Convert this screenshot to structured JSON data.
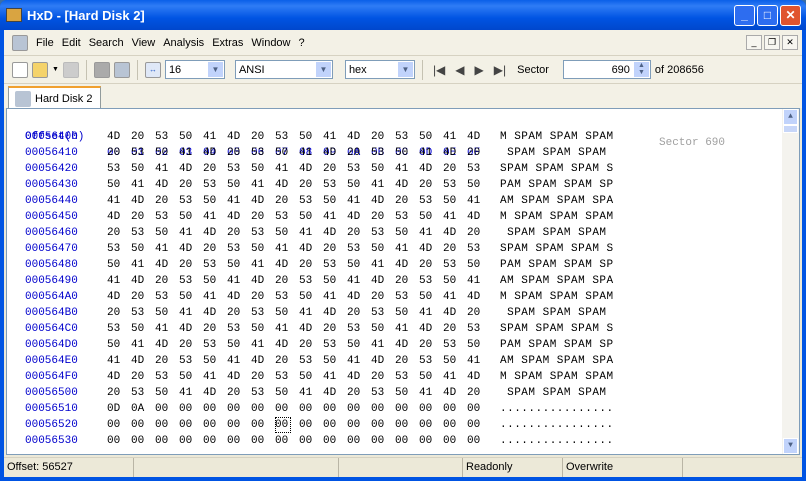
{
  "window": {
    "title": "HxD - [Hard Disk 2]",
    "app_icon_text": "HxD"
  },
  "menu": [
    "File",
    "Edit",
    "Search",
    "View",
    "Analysis",
    "Extras",
    "Window",
    "?"
  ],
  "toolbar": {
    "bytes_per_row": "16",
    "charset": "ANSI",
    "offset_base": "hex",
    "sector_label": "Sector",
    "sector_value": "690",
    "sector_total": "of 208656"
  },
  "tab": {
    "label": "Hard Disk 2"
  },
  "editor": {
    "header_offset": "Offset(h)",
    "header_cols": [
      "00",
      "01",
      "02",
      "03",
      "04",
      "05",
      "06",
      "07",
      "08",
      "09",
      "0A",
      "0B",
      "0C",
      "0D",
      "0E",
      "0F"
    ],
    "sector_annotation": "Sector 690",
    "rows": [
      {
        "offset": "00056400",
        "hex": [
          "4D",
          "20",
          "53",
          "50",
          "41",
          "4D",
          "20",
          "53",
          "50",
          "41",
          "4D",
          "20",
          "53",
          "50",
          "41",
          "4D"
        ],
        "text": "M SPAM SPAM SPAM"
      },
      {
        "offset": "00056410",
        "hex": [
          "20",
          "53",
          "50",
          "41",
          "4D",
          "20",
          "53",
          "50",
          "41",
          "4D",
          "20",
          "53",
          "50",
          "41",
          "4D",
          "20"
        ],
        "text": " SPAM SPAM SPAM "
      },
      {
        "offset": "00056420",
        "hex": [
          "53",
          "50",
          "41",
          "4D",
          "20",
          "53",
          "50",
          "41",
          "4D",
          "20",
          "53",
          "50",
          "41",
          "4D",
          "20",
          "53"
        ],
        "text": "SPAM SPAM SPAM S"
      },
      {
        "offset": "00056430",
        "hex": [
          "50",
          "41",
          "4D",
          "20",
          "53",
          "50",
          "41",
          "4D",
          "20",
          "53",
          "50",
          "41",
          "4D",
          "20",
          "53",
          "50"
        ],
        "text": "PAM SPAM SPAM SP"
      },
      {
        "offset": "00056440",
        "hex": [
          "41",
          "4D",
          "20",
          "53",
          "50",
          "41",
          "4D",
          "20",
          "53",
          "50",
          "41",
          "4D",
          "20",
          "53",
          "50",
          "41"
        ],
        "text": "AM SPAM SPAM SPA"
      },
      {
        "offset": "00056450",
        "hex": [
          "4D",
          "20",
          "53",
          "50",
          "41",
          "4D",
          "20",
          "53",
          "50",
          "41",
          "4D",
          "20",
          "53",
          "50",
          "41",
          "4D"
        ],
        "text": "M SPAM SPAM SPAM"
      },
      {
        "offset": "00056460",
        "hex": [
          "20",
          "53",
          "50",
          "41",
          "4D",
          "20",
          "53",
          "50",
          "41",
          "4D",
          "20",
          "53",
          "50",
          "41",
          "4D",
          "20"
        ],
        "text": " SPAM SPAM SPAM "
      },
      {
        "offset": "00056470",
        "hex": [
          "53",
          "50",
          "41",
          "4D",
          "20",
          "53",
          "50",
          "41",
          "4D",
          "20",
          "53",
          "50",
          "41",
          "4D",
          "20",
          "53"
        ],
        "text": "SPAM SPAM SPAM S"
      },
      {
        "offset": "00056480",
        "hex": [
          "50",
          "41",
          "4D",
          "20",
          "53",
          "50",
          "41",
          "4D",
          "20",
          "53",
          "50",
          "41",
          "4D",
          "20",
          "53",
          "50"
        ],
        "text": "PAM SPAM SPAM SP"
      },
      {
        "offset": "00056490",
        "hex": [
          "41",
          "4D",
          "20",
          "53",
          "50",
          "41",
          "4D",
          "20",
          "53",
          "50",
          "41",
          "4D",
          "20",
          "53",
          "50",
          "41"
        ],
        "text": "AM SPAM SPAM SPA"
      },
      {
        "offset": "000564A0",
        "hex": [
          "4D",
          "20",
          "53",
          "50",
          "41",
          "4D",
          "20",
          "53",
          "50",
          "41",
          "4D",
          "20",
          "53",
          "50",
          "41",
          "4D"
        ],
        "text": "M SPAM SPAM SPAM"
      },
      {
        "offset": "000564B0",
        "hex": [
          "20",
          "53",
          "50",
          "41",
          "4D",
          "20",
          "53",
          "50",
          "41",
          "4D",
          "20",
          "53",
          "50",
          "41",
          "4D",
          "20"
        ],
        "text": " SPAM SPAM SPAM "
      },
      {
        "offset": "000564C0",
        "hex": [
          "53",
          "50",
          "41",
          "4D",
          "20",
          "53",
          "50",
          "41",
          "4D",
          "20",
          "53",
          "50",
          "41",
          "4D",
          "20",
          "53"
        ],
        "text": "SPAM SPAM SPAM S"
      },
      {
        "offset": "000564D0",
        "hex": [
          "50",
          "41",
          "4D",
          "20",
          "53",
          "50",
          "41",
          "4D",
          "20",
          "53",
          "50",
          "41",
          "4D",
          "20",
          "53",
          "50"
        ],
        "text": "PAM SPAM SPAM SP"
      },
      {
        "offset": "000564E0",
        "hex": [
          "41",
          "4D",
          "20",
          "53",
          "50",
          "41",
          "4D",
          "20",
          "53",
          "50",
          "41",
          "4D",
          "20",
          "53",
          "50",
          "41"
        ],
        "text": "AM SPAM SPAM SPA"
      },
      {
        "offset": "000564F0",
        "hex": [
          "4D",
          "20",
          "53",
          "50",
          "41",
          "4D",
          "20",
          "53",
          "50",
          "41",
          "4D",
          "20",
          "53",
          "50",
          "41",
          "4D"
        ],
        "text": "M SPAM SPAM SPAM"
      },
      {
        "offset": "00056500",
        "hex": [
          "20",
          "53",
          "50",
          "41",
          "4D",
          "20",
          "53",
          "50",
          "41",
          "4D",
          "20",
          "53",
          "50",
          "41",
          "4D",
          "20"
        ],
        "text": " SPAM SPAM SPAM "
      },
      {
        "offset": "00056510",
        "hex": [
          "0D",
          "0A",
          "00",
          "00",
          "00",
          "00",
          "00",
          "00",
          "00",
          "00",
          "00",
          "00",
          "00",
          "00",
          "00",
          "00"
        ],
        "text": "................"
      },
      {
        "offset": "00056520",
        "hex": [
          "00",
          "00",
          "00",
          "00",
          "00",
          "00",
          "00",
          "00",
          "00",
          "00",
          "00",
          "00",
          "00",
          "00",
          "00",
          "00"
        ],
        "text": "................"
      },
      {
        "offset": "00056530",
        "hex": [
          "00",
          "00",
          "00",
          "00",
          "00",
          "00",
          "00",
          "00",
          "00",
          "00",
          "00",
          "00",
          "00",
          "00",
          "00",
          "00"
        ],
        "text": "................"
      }
    ]
  },
  "status": {
    "offset": "Offset: 56527",
    "mode": "Readonly",
    "insert": "Overwrite"
  }
}
